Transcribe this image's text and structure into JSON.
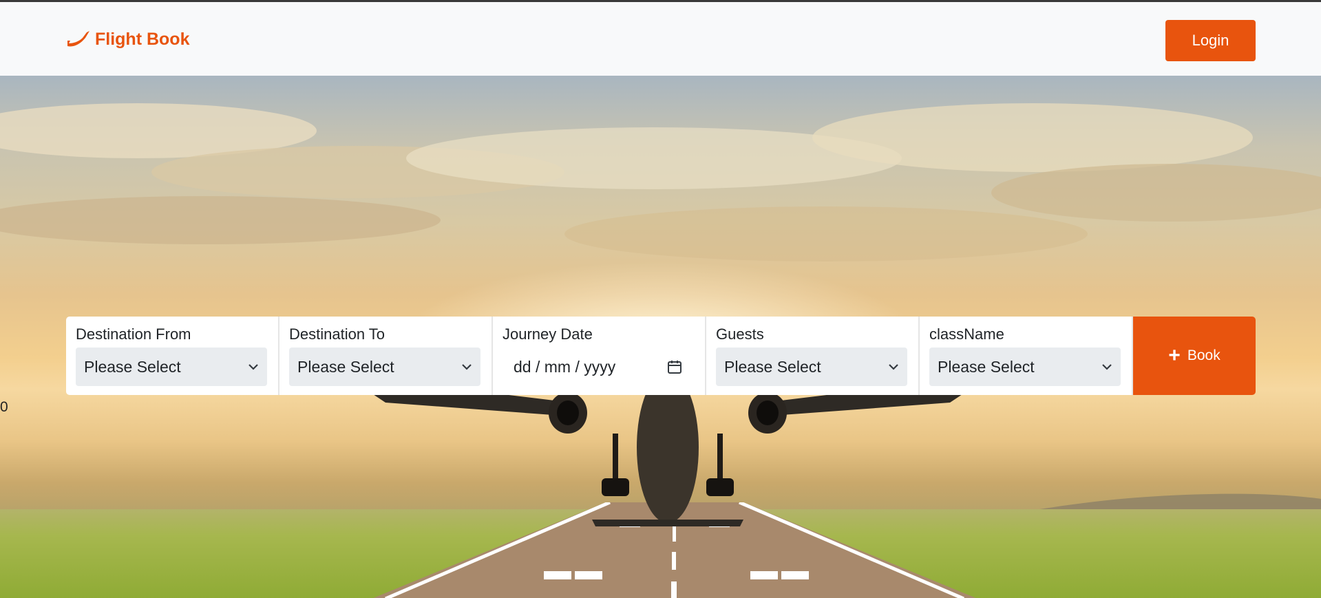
{
  "navbar": {
    "brand_name": "Flight Book",
    "login_label": "Login"
  },
  "stray_text": "0",
  "search": {
    "from": {
      "label": "Destination From",
      "value": "Please Select"
    },
    "to": {
      "label": "Destination To",
      "value": "Please Select"
    },
    "date": {
      "label": "Journey Date",
      "placeholder": "dd / mm / yyyy"
    },
    "guests": {
      "label": "Guests",
      "value": "Please Select"
    },
    "class": {
      "label": "className",
      "value": "Please Select"
    },
    "book_label": "Book"
  },
  "icons": {
    "brand": "plane-logo-icon",
    "calendar": "calendar-icon",
    "chevron": "chevron-down-icon",
    "plus": "plus-icon"
  },
  "colors": {
    "accent": "#e8540e",
    "navbar_bg": "#f8f9fa",
    "select_bg": "#e9ecef"
  }
}
